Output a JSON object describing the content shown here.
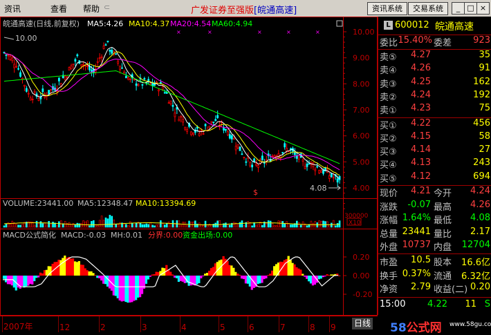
{
  "menu": {
    "items": [
      "资讯",
      "查看",
      "帮助"
    ]
  },
  "title": {
    "prefix": "广发证券至强版",
    "stock": "[皖通高速]"
  },
  "buttons": {
    "news": "资讯系统",
    "trade": "交易系统",
    "min": "_",
    "max": "□",
    "close": "×"
  },
  "chart_header": {
    "name": "皖通高速(日线,前复权)",
    "ma5": "MA5:4.26",
    "ma10": "MA10:4.37",
    "ma20": "MA20:4.54",
    "ma60": "MA60:4.94"
  },
  "colors": {
    "ma5": "#ffffff",
    "ma10": "#ffff00",
    "ma20": "#ff00ff",
    "ma60": "#00ff00",
    "up": "#ff0000",
    "down": "#00ffff",
    "grid": "#800000",
    "axis": "#c00000"
  },
  "price_axis": {
    "ticks": [
      "10.00",
      "9.00",
      "8.00",
      "7.00",
      "6.00",
      "5.00",
      "4.00"
    ],
    "high_mark": "10.00",
    "low_mark": "4.08",
    "marker": "$"
  },
  "volume": {
    "label": "VOLUME:23441.00",
    "ma5": "MA5:12348.47",
    "ma10": "MA10:13394.69",
    "axis_top": "300000",
    "axis_unit": "X10"
  },
  "macd": {
    "label": "MACD公式简化",
    "macd": "MACD:-0.03",
    "mh": "MH:0.01",
    "fenjie": "分界:0.00",
    "zijin": "资金出场:0.00",
    "ticks": [
      "0.20",
      "0.00",
      "-0.20"
    ]
  },
  "months": [
    "2007年",
    "12",
    "2",
    "3",
    "4",
    "5",
    "6",
    "7",
    "8",
    "9"
  ],
  "bottom": {
    "tab": "日线",
    "watermark_prefix": "58",
    "watermark_suffix": "公式网",
    "watermark_url": "www.58gu.com"
  },
  "panel": {
    "code": "600012",
    "name": "皖通高速",
    "badge": "L",
    "weibi_label": "委比",
    "weibi": "15.40%",
    "weicha_label": "委差",
    "weicha": "923",
    "sells": [
      {
        "label": "卖⑤",
        "price": "4.27",
        "vol": "35"
      },
      {
        "label": "卖④",
        "price": "4.26",
        "vol": "91"
      },
      {
        "label": "卖③",
        "price": "4.25",
        "vol": "162"
      },
      {
        "label": "卖②",
        "price": "4.24",
        "vol": "192"
      },
      {
        "label": "卖①",
        "price": "4.23",
        "vol": "75"
      }
    ],
    "buys": [
      {
        "label": "买①",
        "price": "4.22",
        "vol": "456"
      },
      {
        "label": "买②",
        "price": "4.15",
        "vol": "58"
      },
      {
        "label": "买③",
        "price": "4.14",
        "vol": "27"
      },
      {
        "label": "买④",
        "price": "4.13",
        "vol": "243"
      },
      {
        "label": "买⑤",
        "price": "4.12",
        "vol": "694"
      }
    ],
    "stats": [
      {
        "l1": "现价",
        "v1": "4.21",
        "l2": "今开",
        "v2": "4.24"
      },
      {
        "l1": "涨跌",
        "v1": "-0.07",
        "l2": "最高",
        "v2": "4.26"
      },
      {
        "l1": "涨幅",
        "v1": "1.64%",
        "l2": "最低",
        "v2": "4.08"
      },
      {
        "l1": "总量",
        "v1": "23441",
        "l2": "量比",
        "v2": "2.17"
      },
      {
        "l1": "外盘",
        "v1": "10737",
        "l2": "内盘",
        "v2": "12704"
      },
      {
        "l1": "市盈",
        "v1": "10.5",
        "l2": "股本",
        "v2": "16.6亿"
      },
      {
        "l1": "换手",
        "v1": "0.37%",
        "l2": "流通",
        "v2": "6.32亿"
      },
      {
        "l1": "净资",
        "v1": "2.79",
        "l2": "收益(二)",
        "v2": "0.20"
      }
    ],
    "tick": {
      "time": "15:00",
      "price": "4.22",
      "vol": "11",
      "side": "S"
    }
  }
}
